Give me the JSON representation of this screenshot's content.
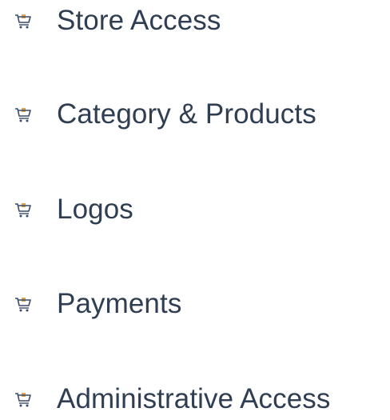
{
  "menu": {
    "icon": "shopping-cart-icon",
    "colors": {
      "text": "#2f3e52",
      "icon_stroke": "#3a4a6b",
      "icon_accent": "#e8a33a"
    },
    "items": [
      {
        "label": "Store Access"
      },
      {
        "label": "Category & Products"
      },
      {
        "label": "Logos"
      },
      {
        "label": "Payments"
      },
      {
        "label": "Administrative Access"
      }
    ]
  }
}
